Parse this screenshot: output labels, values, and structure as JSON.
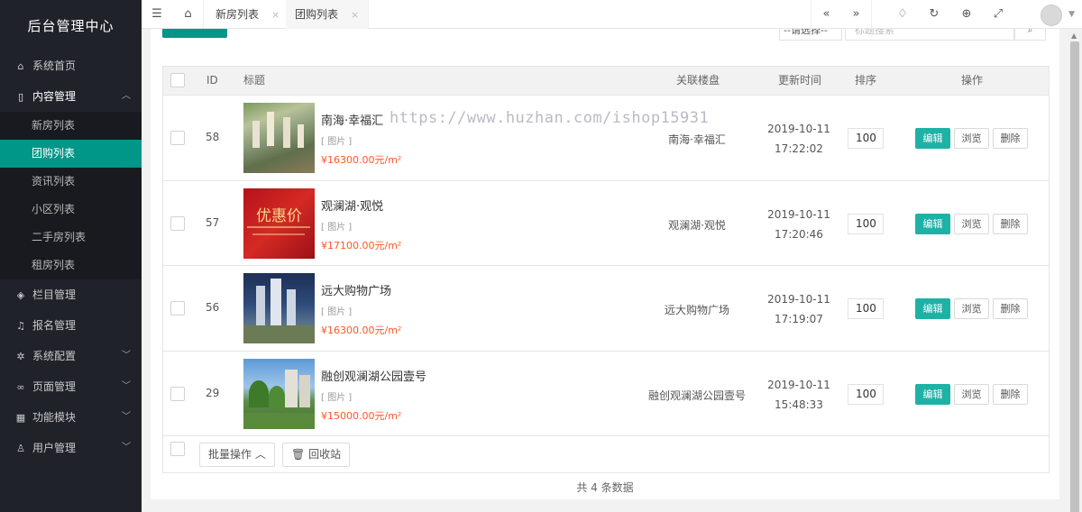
{
  "app": {
    "title": "后台管理中心"
  },
  "sidebar": {
    "items": [
      {
        "label": "系统首页",
        "icon": "home-icon"
      },
      {
        "label": "内容管理",
        "icon": "document-icon",
        "expanded": true,
        "children": [
          {
            "label": "新房列表"
          },
          {
            "label": "团购列表",
            "active": true
          },
          {
            "label": "资讯列表"
          },
          {
            "label": "小区列表"
          },
          {
            "label": "二手房列表"
          },
          {
            "label": "租房列表"
          }
        ]
      },
      {
        "label": "栏目管理",
        "icon": "layers-icon"
      },
      {
        "label": "报名管理",
        "icon": "bell-icon"
      },
      {
        "label": "系统配置",
        "icon": "gear-icon"
      },
      {
        "label": "页面管理",
        "icon": "link-icon"
      },
      {
        "label": "功能模块",
        "icon": "module-icon"
      },
      {
        "label": "用户管理",
        "icon": "user-icon"
      }
    ]
  },
  "topbar": {
    "tabs": [
      {
        "label": "新房列表",
        "close": "×"
      },
      {
        "label": "团购列表",
        "close": "×",
        "active": true
      }
    ]
  },
  "toolbar": {
    "select_value": "--请选择--",
    "search_placeholder": "标题搜索"
  },
  "table": {
    "headers": {
      "id": "ID",
      "title": "标题",
      "property": "关联楼盘",
      "updated": "更新时间",
      "sort": "排序",
      "actions": "操作"
    },
    "rows": [
      {
        "id": "58",
        "title": "南海·幸福汇",
        "tag": "[ 图片 ]",
        "price": "¥16300.00元/m²",
        "property": "南海·幸福汇",
        "date": "2019-10-11",
        "time": "17:22:02",
        "sort": "100"
      },
      {
        "id": "57",
        "title": "观澜湖·观悦",
        "tag": "[ 图片 ]",
        "price": "¥17100.00元/m²",
        "property": "观澜湖·观悦",
        "date": "2019-10-11",
        "time": "17:20:46",
        "sort": "100"
      },
      {
        "id": "56",
        "title": "远大购物广场",
        "tag": "[ 图片 ]",
        "price": "¥16300.00元/m²",
        "property": "远大购物广场",
        "date": "2019-10-11",
        "time": "17:19:07",
        "sort": "100"
      },
      {
        "id": "29",
        "title": "融创观澜湖公园壹号",
        "tag": "[ 图片 ]",
        "price": "¥15000.00元/m²",
        "property": "融创观澜湖公园壹号",
        "date": "2019-10-11",
        "time": "15:48:33",
        "sort": "100"
      }
    ],
    "row_buttons": {
      "edit": "编辑",
      "view": "浏览",
      "delete": "删除"
    },
    "thumb_text": "优惠价"
  },
  "footer": {
    "batch_label": "批量操作",
    "recycle_label": "回收站",
    "total_text": "共 4 条数据"
  },
  "watermark": "https://www.huzhan.com/ishop15931",
  "colors": {
    "accent": "#009688",
    "edit_button": "#1eb2a6",
    "price": "#ff5722",
    "sidebar_bg": "#20222a"
  }
}
